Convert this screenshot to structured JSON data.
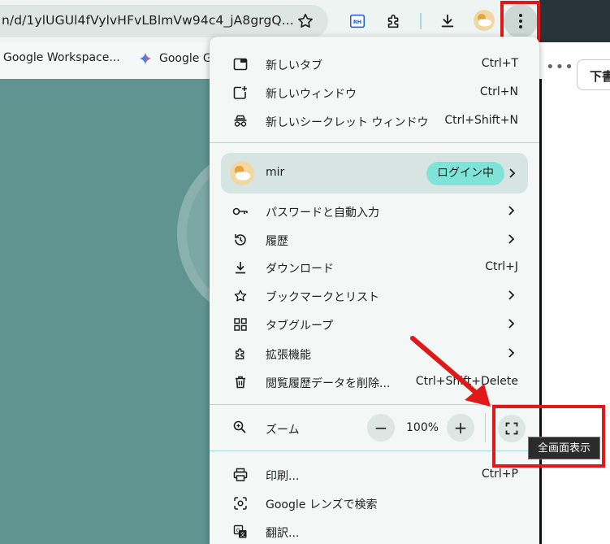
{
  "browser": {
    "url": "n/d/1ylUGUl4fVylvHFvLBlmVw94c4_jA8grgQ...",
    "bookmarks": [
      {
        "label": "Google Workspace..."
      },
      {
        "label": "Google G"
      }
    ],
    "rh_icon_label": "RH"
  },
  "page": {
    "draft_button": "下書"
  },
  "menu": {
    "group1": [
      {
        "label": "新しいタブ",
        "shortcut": "Ctrl+T",
        "icon": "new-tab-icon"
      },
      {
        "label": "新しいウィンドウ",
        "shortcut": "Ctrl+N",
        "icon": "new-window-icon"
      },
      {
        "label": "新しいシークレット ウィンドウ",
        "shortcut": "Ctrl+Shift+N",
        "icon": "incognito-icon"
      }
    ],
    "profile": {
      "name": "mir",
      "status": "ログイン中"
    },
    "group2": [
      {
        "label": "パスワードと自動入力",
        "icon": "key-icon"
      },
      {
        "label": "履歴",
        "icon": "history-icon"
      },
      {
        "label": "ダウンロード",
        "shortcut": "Ctrl+J",
        "icon": "download-icon"
      },
      {
        "label": "ブックマークとリスト",
        "icon": "star-icon"
      },
      {
        "label": "タブグループ",
        "icon": "tab-groups-icon"
      },
      {
        "label": "拡張機能",
        "icon": "extension-icon"
      },
      {
        "label": "閲覧履歴データを削除...",
        "shortcut": "Ctrl+Shift+Delete",
        "icon": "trash-icon"
      }
    ],
    "zoom": {
      "label": "ズーム",
      "value": "100%",
      "minus": "−",
      "plus": "+"
    },
    "group3": [
      {
        "label": "印刷...",
        "shortcut": "Ctrl+P",
        "icon": "print-icon"
      },
      {
        "label": "Google レンズで検索",
        "icon": "lens-icon"
      },
      {
        "label": "翻訳...",
        "icon": "translate-icon"
      }
    ]
  },
  "tooltip": {
    "text": "全画面表示"
  },
  "colors": {
    "highlight_red": "#e01818",
    "menu_bg": "#f3f8f7",
    "page_bg": "#5f9491",
    "badge": "#7fe3d8",
    "separator": "#a9d6e8"
  }
}
